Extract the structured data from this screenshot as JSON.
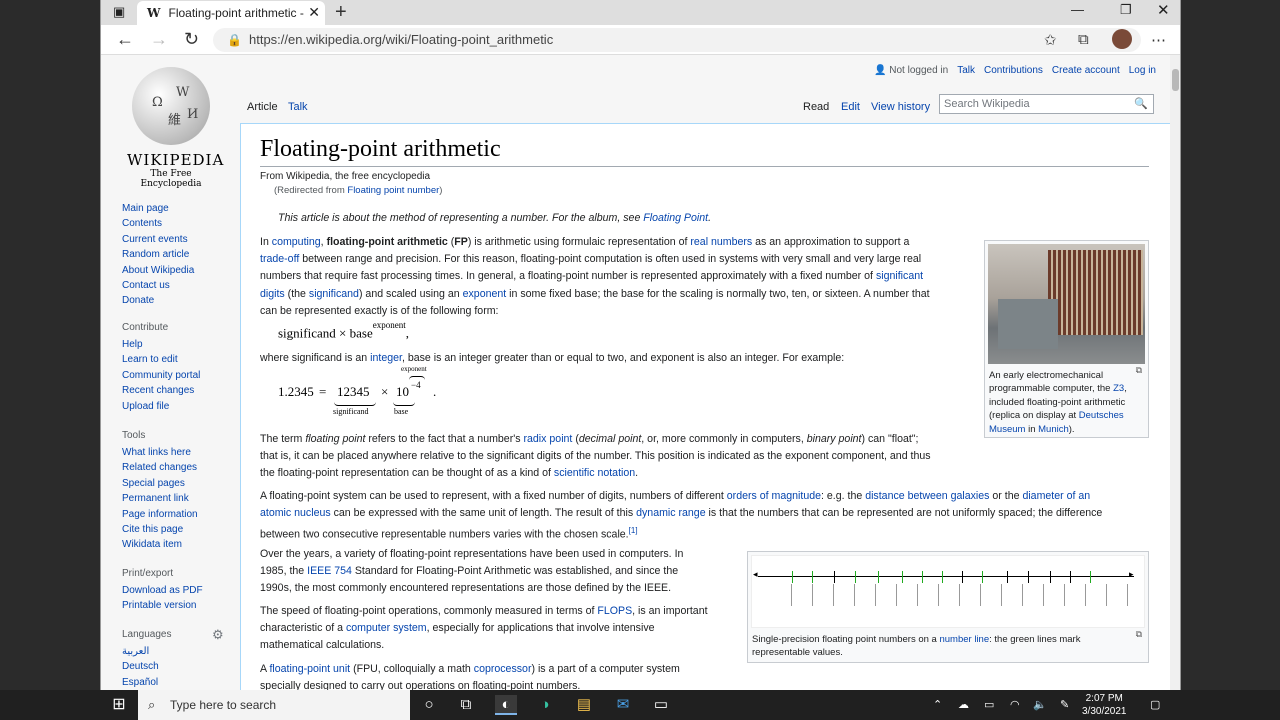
{
  "browser": {
    "tab_title": "Floating-point arithmetic - Wikip",
    "url": "https://en.wikipedia.org/wiki/Floating-point_arithmetic"
  },
  "logo": {
    "wordmark": "Wikipedia",
    "tagline": "The Free Encyclopedia",
    "glyphs": [
      "Ω",
      "W",
      "維",
      "И"
    ]
  },
  "sidebar": {
    "nav": [
      "Main page",
      "Contents",
      "Current events",
      "Random article",
      "About Wikipedia",
      "Contact us",
      "Donate"
    ],
    "contribute_header": "Contribute",
    "contribute": [
      "Help",
      "Learn to edit",
      "Community portal",
      "Recent changes",
      "Upload file"
    ],
    "tools_header": "Tools",
    "tools": [
      "What links here",
      "Related changes",
      "Special pages",
      "Permanent link",
      "Page information",
      "Cite this page",
      "Wikidata item"
    ],
    "print_header": "Print/export",
    "print": [
      "Download as PDF",
      "Printable version"
    ],
    "languages_header": "Languages",
    "languages": [
      "العربية",
      "Deutsch",
      "Español"
    ]
  },
  "user_links": {
    "not_logged_in": "Not logged in",
    "talk": "Talk",
    "contributions": "Contributions",
    "create_account": "Create account",
    "log_in": "Log in"
  },
  "page_tabs": {
    "article": "Article",
    "talk": "Talk",
    "read": "Read",
    "edit": "Edit",
    "history": "View history"
  },
  "search": {
    "placeholder": "Search Wikipedia"
  },
  "article": {
    "title": "Floating-point arithmetic",
    "from": "From Wikipedia, the free encyclopedia",
    "redirect_prefix": "(Redirected from ",
    "redirect_link": "Floating point number",
    "redirect_suffix": ")",
    "hatnote_text": "This article is about the method of representing a number. For the album, see ",
    "hatnote_link": "Floating Point",
    "hatnote_end": ".",
    "p1": {
      "l1a": "In ",
      "l1b": "computing",
      "l1c": ", ",
      "l1d": "floating-point arithmetic",
      "l1e": " (",
      "l1f": "FP",
      "l1g": ") is arithmetic using formulaic representation of ",
      "l1h": "real numbers",
      "l1i": " as an approximation to support a",
      "l2a": "trade-off",
      "l2b": " between range and precision. For this reason, floating-point computation is often used in systems with very small and very large real",
      "l3a": "numbers that require fast processing times. In general, a floating-point number is represented approximately with a fixed number of ",
      "l3b": "significant",
      "l4a": "digits",
      "l4b": " (the ",
      "l4c": "significand",
      "l4d": ") and scaled using an ",
      "l4e": "exponent",
      "l4f": " in some fixed base; the base for the scaling is normally two, ten, or sixteen. A number that",
      "l5": "can be represented exactly is of the following form:"
    },
    "formula1": {
      "sig": "significand",
      "times": "×",
      "base": "base",
      "exp": "exponent",
      "end": ","
    },
    "p2": {
      "a": "where significand is an ",
      "b": "integer",
      "c": ", base is an integer greater than or equal to two, and exponent is also an integer. For example:"
    },
    "formula2": {
      "lhs": "1.2345",
      "eq": "=",
      "sig": "12345",
      "times": "×",
      "base": "10",
      "exp": "−4",
      "label_sig": "significand",
      "label_base": "base",
      "label_exp": "exponent",
      "end": "."
    },
    "p3": {
      "l1a": "The term ",
      "l1b": "floating point",
      "l1c": " refers to the fact that a number's ",
      "l1d": "radix point",
      "l1e": " (",
      "l1f": "decimal point",
      "l1g": ", or, more commonly in computers, ",
      "l1h": "binary point",
      "l1i": ") can \"float\";",
      "l2": "that is, it can be placed anywhere relative to the significant digits of the number. This position is indicated as the exponent component, and thus",
      "l3a": "the floating-point representation can be thought of as a kind of ",
      "l3b": "scientific notation",
      "l3c": "."
    },
    "p4": {
      "l1a": "A floating-point system can be used to represent, with a fixed number of digits, numbers of different ",
      "l1b": "orders of magnitude",
      "l1c": ": e.g. the ",
      "l1d": "distance between galaxies",
      "l1e": " or the ",
      "l1f": "diameter of an",
      "l2a": "atomic nucleus",
      "l2b": " can be expressed with the same unit of length. The result of this ",
      "l2c": "dynamic range",
      "l2d": " is that the numbers that can be represented are not uniformly spaced; the difference",
      "l3a": "between two consecutive representable numbers varies with the chosen scale.",
      "l3b": "[1]"
    },
    "p5": {
      "l1": "Over the years, a variety of floating-point representations have been used in computers. In",
      "l2a": "1985, the ",
      "l2b": "IEEE 754",
      "l2c": " Standard for Floating-Point Arithmetic was established, and since the",
      "l3": "1990s, the most commonly encountered representations are those defined by the IEEE."
    },
    "p6": {
      "l1a": "The speed of floating-point operations, commonly measured in terms of ",
      "l1b": "FLOPS",
      "l1c": ", is an important",
      "l2a": "characteristic of a ",
      "l2b": "computer system",
      "l2c": ", especially for applications that involve intensive",
      "l3": "mathematical calculations."
    },
    "p7": {
      "l1a": "A ",
      "l1b": "floating-point unit",
      "l1c": " (FPU, colloquially a math ",
      "l1d": "coprocessor",
      "l1e": ") is a part of a computer system",
      "l2": "specially designed to carry out operations on floating-point numbers."
    }
  },
  "infobox1": {
    "l1": "An early electromechanical",
    "l2a": "programmable computer, the ",
    "l2b": "Z3",
    "l2c": ",",
    "l3": "included floating-point arithmetic",
    "l4a": "(replica on display at ",
    "l4b": "Deutsches",
    "l5a": "Museum",
    "l5b": " in ",
    "l5c": "Munich",
    "l5d": ")."
  },
  "infobox2": {
    "l1a": "Single-precision floating point numbers on a ",
    "l1b": "number line",
    "l1c": ": the green lines mark",
    "l2": "representable values."
  },
  "taskbar": {
    "search_placeholder": "Type here to search",
    "time": "2:07 PM",
    "date": "3/30/2021"
  }
}
